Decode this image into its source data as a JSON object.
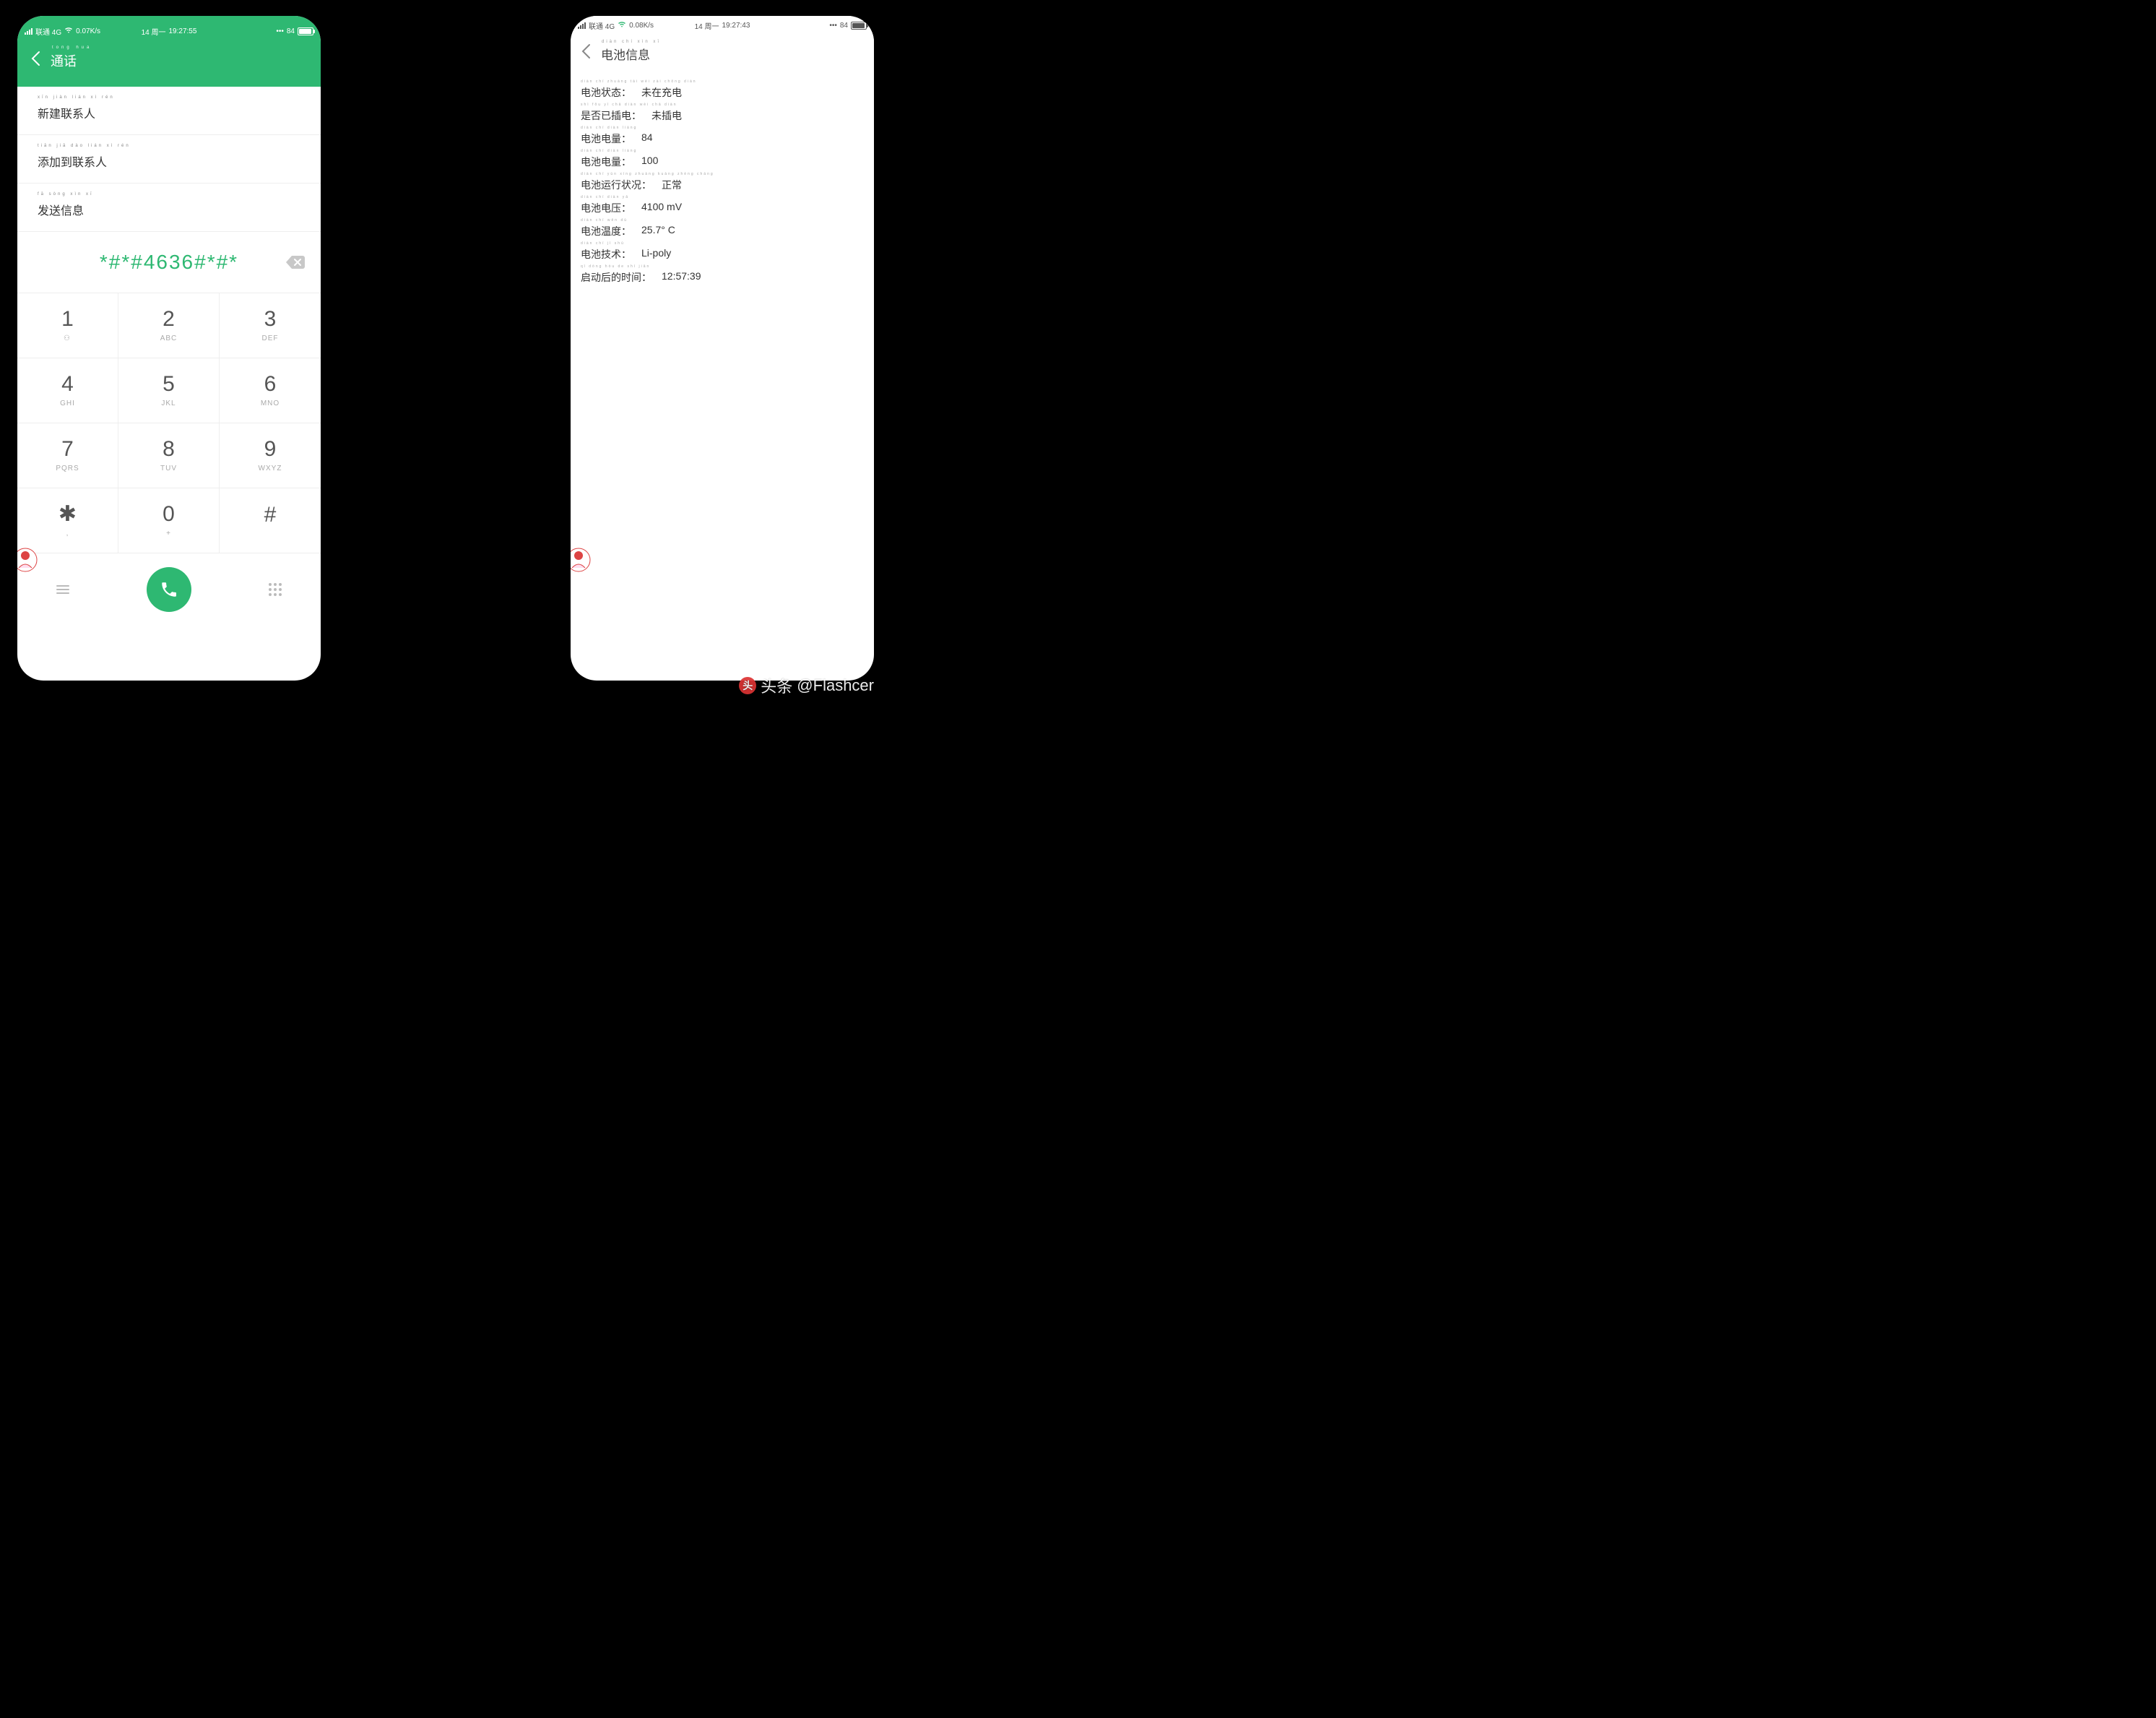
{
  "leftPhone": {
    "statusbar": {
      "carrier": "联通 4G",
      "speed": "0.07K/s",
      "date": "14 周一",
      "time": "19:27:55",
      "battery": "84"
    },
    "header": {
      "title_pinyin": "tōng huà",
      "title": "通话"
    },
    "menu": [
      {
        "pinyin": "xīn jiàn lián xì rén",
        "label": "新建联系人"
      },
      {
        "pinyin": "tiān jiā dào lián xì rén",
        "label": "添加到联系人"
      },
      {
        "pinyin": "fā sòng xìn xī",
        "label": "发送信息"
      }
    ],
    "dialed_number": "*#*#4636#*#*",
    "keypad": [
      {
        "digit": "1",
        "letters": "",
        "sub": "⚇"
      },
      {
        "digit": "2",
        "letters": "ABC"
      },
      {
        "digit": "3",
        "letters": "DEF"
      },
      {
        "digit": "4",
        "letters": "GHI"
      },
      {
        "digit": "5",
        "letters": "JKL"
      },
      {
        "digit": "6",
        "letters": "MNO"
      },
      {
        "digit": "7",
        "letters": "PQRS"
      },
      {
        "digit": "8",
        "letters": "TUV"
      },
      {
        "digit": "9",
        "letters": "WXYZ"
      },
      {
        "digit": "✱",
        "letters": ","
      },
      {
        "digit": "0",
        "letters": "+"
      },
      {
        "digit": "#",
        "letters": ""
      }
    ]
  },
  "rightPhone": {
    "statusbar": {
      "carrier": "联通 4G",
      "speed": "0.08K/s",
      "date": "14 周一",
      "time": "19:27:43",
      "battery": "84"
    },
    "header": {
      "title_pinyin": "diàn chí xìn xī",
      "title": "电池信息"
    },
    "rows": [
      {
        "pinyin": "diàn chí zhuàng tài          wèi zài chōng diàn",
        "label": "电池状态：",
        "value": "未在充电"
      },
      {
        "pinyin": "shì fǒu yǐ chā diàn          wèi chā diàn",
        "label": "是否已插电：",
        "value": "未插电"
      },
      {
        "pinyin": "diàn chí diàn liàng",
        "label": "电池电量：",
        "value": "84"
      },
      {
        "pinyin": "diàn chí diàn liàng",
        "label": "电池电量：",
        "value": "100"
      },
      {
        "pinyin": "diàn chí yùn xíng zhuàng kuàng   zhèng cháng",
        "label": "电池运行状况：",
        "value": "正常"
      },
      {
        "pinyin": "diàn chí diàn yā",
        "label": "电池电压：",
        "value": "4100 mV"
      },
      {
        "pinyin": "diàn chí wēn dù",
        "label": "电池温度：",
        "value": "25.7° C"
      },
      {
        "pinyin": "diàn chí jì shù",
        "label": "电池技术：",
        "value": "Li-poly"
      },
      {
        "pinyin": "qǐ dòng hòu de shí jiān",
        "label": "启动后的时间：",
        "value": "12:57:39"
      }
    ]
  },
  "watermark": {
    "prefix": "头条",
    "handle": "@Flashcer"
  }
}
